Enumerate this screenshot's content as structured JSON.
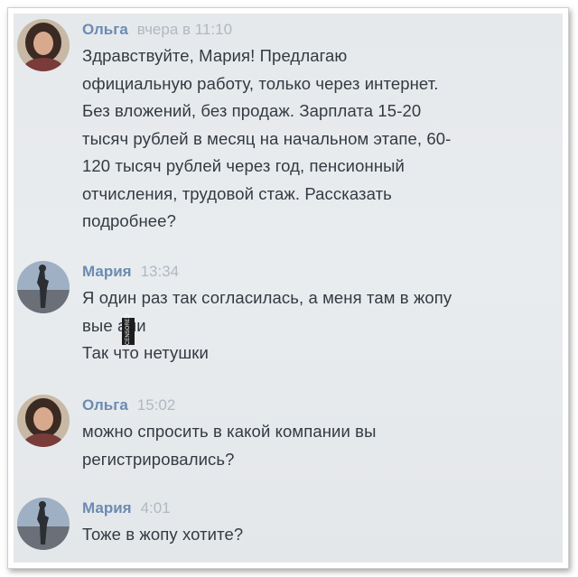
{
  "messages": [
    {
      "author": "Ольга",
      "time": "вчера в 11:10",
      "lines": [
        "Здравствуйте, Мария! Предлагаю",
        "официальную работу, только через интернет.",
        "Без вложений, без продаж. Зарплата 15-20",
        "тысяч рублей в месяц на начальном этапе, 60-",
        "120 тысяч рублей через год, пенсионный",
        "отчисления, трудовой стаж. Рассказать",
        "подробнее?"
      ]
    },
    {
      "author": "Мария",
      "time": "13:34",
      "lines": [
        "Я один раз так согласилась, а меня там в жопу",
        "вые али",
        "Так что нетушки"
      ]
    },
    {
      "author": "Ольга",
      "time": "15:02",
      "lines": [
        "можно спросить в какой компании вы",
        "регистрировались?"
      ]
    },
    {
      "author": "Мария",
      "time": "4:01",
      "lines": [
        "Тоже в жопу хотите?"
      ]
    }
  ],
  "watermark": "CENSORED",
  "colors": {
    "author": "#6b8bb2",
    "time": "#b0b8c2",
    "text": "#333a42",
    "background": "#e7eaed"
  },
  "icons": {
    "olga_avatar": "woman-portrait-avatar",
    "maria_avatar": "figure-silhouette-avatar"
  }
}
